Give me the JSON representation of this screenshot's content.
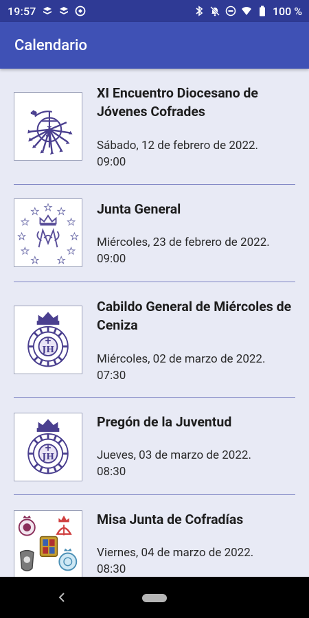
{
  "status_bar": {
    "time": "19:57",
    "battery": "100 %"
  },
  "app_bar": {
    "title": "Calendario"
  },
  "events": [
    {
      "title": "XI Encuentro Diocesano de Jóvenes Cofrades",
      "date": "Sábado, 12 de febrero de 2022. 09:00",
      "image": "cross-arrows-emblem"
    },
    {
      "title": "Junta General",
      "date": "Miércoles, 23 de febrero de 2022. 09:00",
      "image": "crowned-marian-monogram-with-stars"
    },
    {
      "title": "Cabildo General de Miércoles de Ceniza",
      "date": "Miércoles, 02 de marzo de 2022. 07:30",
      "image": "crowned-jhs-medallion"
    },
    {
      "title": "Pregón de la Juventud",
      "date": "Jueves, 03 de marzo de 2022. 08:30",
      "image": "crowned-jhs-medallion"
    },
    {
      "title": "Misa Junta de Cofradías",
      "date": "Viernes, 04 de marzo de 2022. 08:30",
      "image": "brotherhood-shields-collage"
    }
  ],
  "colors": {
    "status_bar": "#2f3a95",
    "app_bar": "#3f51b5",
    "background": "#e8eaf5",
    "divider": "#7b82c2",
    "emblem": "#4a3f8f"
  }
}
